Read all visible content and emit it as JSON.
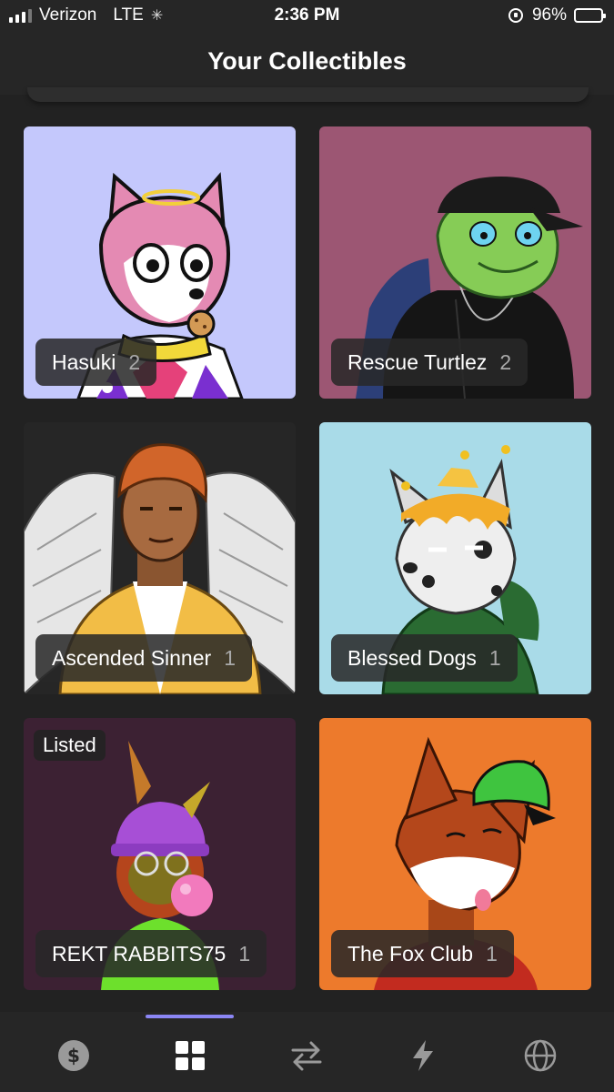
{
  "status_bar": {
    "carrier": "Verizon",
    "network": "LTE",
    "time": "2:36 PM",
    "battery": "96%"
  },
  "header": {
    "title": "Your Collectibles"
  },
  "collectibles": [
    {
      "name": "Hasuki",
      "count": "2",
      "listed": "",
      "bg_color": "#c4c8fc"
    },
    {
      "name": "Rescue Turtlez",
      "count": "2",
      "listed": "",
      "bg_color": "#9c5673"
    },
    {
      "name": "Ascended Sinner",
      "count": "1",
      "listed": "",
      "bg_color": "#262626"
    },
    {
      "name": "Blessed Dogs",
      "count": "1",
      "listed": "",
      "bg_color": "#a9dbe8"
    },
    {
      "name": "REKT RABBITS75",
      "count": "1",
      "listed": "Listed",
      "bg_color": "#3c2133"
    },
    {
      "name": "The Fox Club",
      "count": "1",
      "listed": "",
      "bg_color": "#ed7a2c"
    }
  ],
  "nav": {
    "items": [
      {
        "icon": "dollar-icon",
        "active": false
      },
      {
        "icon": "grid-icon",
        "active": true
      },
      {
        "icon": "swap-icon",
        "active": false
      },
      {
        "icon": "bolt-icon",
        "active": false
      },
      {
        "icon": "globe-icon",
        "active": false
      }
    ],
    "accent_color": "#8b86f4"
  }
}
